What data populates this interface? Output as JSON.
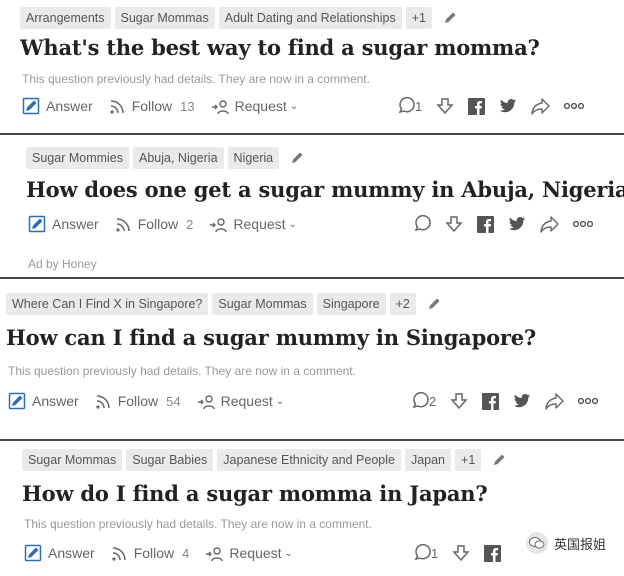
{
  "accent_color": "#2b6dad",
  "cards": [
    {
      "tags": [
        "Arrangements",
        "Sugar Mommas",
        "Adult Dating and Relationships",
        "+1"
      ],
      "title": "What's the best way to find a sugar momma?",
      "details": "This question previously had details. They are now in a comment.",
      "answer_label": "Answer",
      "follow_label": "Follow",
      "follow_count": "13",
      "request_label": "Request",
      "comment_count": "1"
    },
    {
      "tags": [
        "Sugar Mommies",
        "Abuja, Nigeria",
        "Nigeria"
      ],
      "title": "How does one get a sugar mummy in Abuja, Nigeria?",
      "answer_label": "Answer",
      "follow_label": "Follow",
      "follow_count": "2",
      "request_label": "Request",
      "ad_label": "Ad by Honey"
    },
    {
      "tags": [
        "Where Can I Find X in Singapore?",
        "Sugar Mommas",
        "Singapore",
        "+2"
      ],
      "title": "How can I find a sugar mummy in Singapore?",
      "details": "This question previously had details. They are now in a comment.",
      "answer_label": "Answer",
      "follow_label": "Follow",
      "follow_count": "54",
      "request_label": "Request",
      "comment_count": "2"
    },
    {
      "tags": [
        "Sugar Mommas",
        "Sugar Babies",
        "Japanese Ethnicity and People",
        "Japan",
        "+1"
      ],
      "title": "How do I find a sugar momma in Japan?",
      "details": "This question previously had details. They are now in a comment.",
      "answer_label": "Answer",
      "follow_label": "Follow",
      "follow_count": "4",
      "request_label": "Request",
      "comment_count": "1"
    }
  ],
  "watermark": {
    "text": "英国报姐"
  }
}
